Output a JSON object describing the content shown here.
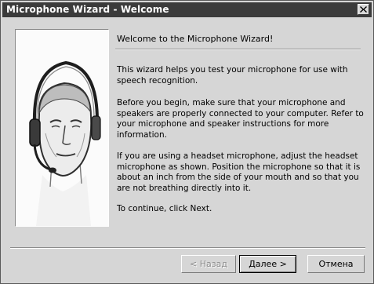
{
  "window": {
    "title": "Microphone Wizard - Welcome",
    "close_glyph": "×"
  },
  "content": {
    "heading": "Welcome to the Microphone Wizard!",
    "paragraphs": [
      "This wizard helps you test your microphone for use with speech recognition.",
      "Before you begin, make sure that your microphone and speakers are properly connected to your computer. Refer to your microphone and speaker instructions for more information.",
      "If you are using a headset microphone, adjust the headset microphone as shown. Position the microphone so that it is about an inch from the side of your mouth and so that you are not breathing directly into it.",
      "To continue, click Next."
    ],
    "illustration": "headset-person-illustration"
  },
  "buttons": {
    "back": "< Назад",
    "next": "Далее >",
    "cancel": "Отмена"
  },
  "colors": {
    "titlebar": "#3b3b3b",
    "face": "#d6d6d6",
    "panel": "#fbfbfb"
  }
}
